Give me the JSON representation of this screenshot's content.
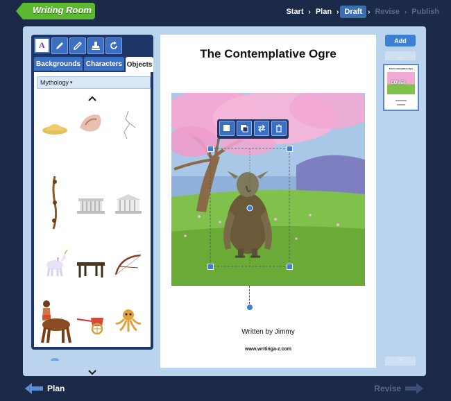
{
  "app": {
    "title": "Writing Room"
  },
  "steps": [
    {
      "label": "Start",
      "state": "done"
    },
    {
      "label": "Plan",
      "state": "done"
    },
    {
      "label": "Draft",
      "state": "active"
    },
    {
      "label": "Revise",
      "state": "disabled"
    },
    {
      "label": "Publish",
      "state": "disabled"
    }
  ],
  "toolbar": {
    "text_tool_label": "A",
    "tools": [
      "text-tool-icon",
      "pen-icon",
      "pencil-icon",
      "stamp-icon",
      "redo-icon"
    ]
  },
  "tabs": [
    {
      "label": "Backgrounds"
    },
    {
      "label": "Characters"
    },
    {
      "label": "Objects"
    }
  ],
  "category": {
    "selected": "Mythology"
  },
  "objects": [
    "sand-pile",
    "conch-shell",
    "cracks",
    "rope",
    "memorial-temple",
    "greek-temple",
    "unicorn",
    "table",
    "bow",
    "centaur",
    "chariot",
    "octopus"
  ],
  "page": {
    "title": "The Contemplative Ogre",
    "byline": "Written by Jimmy",
    "url": "www.writinga-z.com"
  },
  "actions": {
    "add_label": "Add"
  },
  "thumbnail": {
    "title": "The Contemplative Ogre",
    "cover_label": "cover"
  },
  "nav": {
    "back_label": "Plan",
    "forward_label": "Revise"
  },
  "colors": {
    "accent": "#3b6fc4",
    "brand_green": "#5cb82e",
    "background": "#1c2a4a",
    "panel": "#b9d4ec"
  }
}
